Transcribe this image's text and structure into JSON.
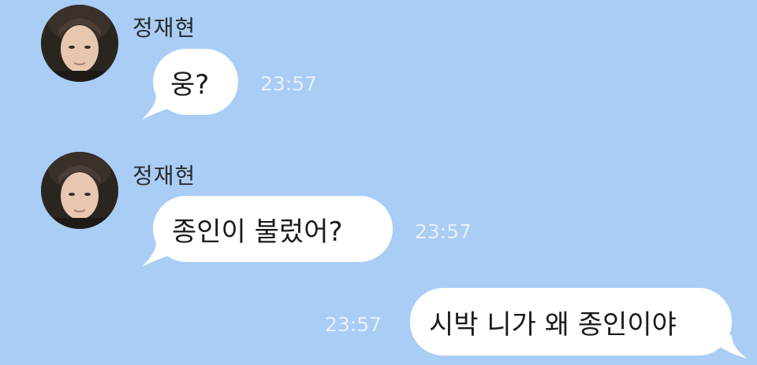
{
  "chat": {
    "background_color": "#a9cdf4",
    "bubble_color": "#ffffff",
    "messages": [
      {
        "direction": "incoming",
        "sender": "정재현",
        "text": "웅?",
        "time": "23:57"
      },
      {
        "direction": "incoming",
        "sender": "정재현",
        "text": "종인이 불렀어?",
        "time": "23:57"
      },
      {
        "direction": "outgoing",
        "text": "시박 니가 왜 종인이야",
        "time": "23:57"
      }
    ]
  }
}
